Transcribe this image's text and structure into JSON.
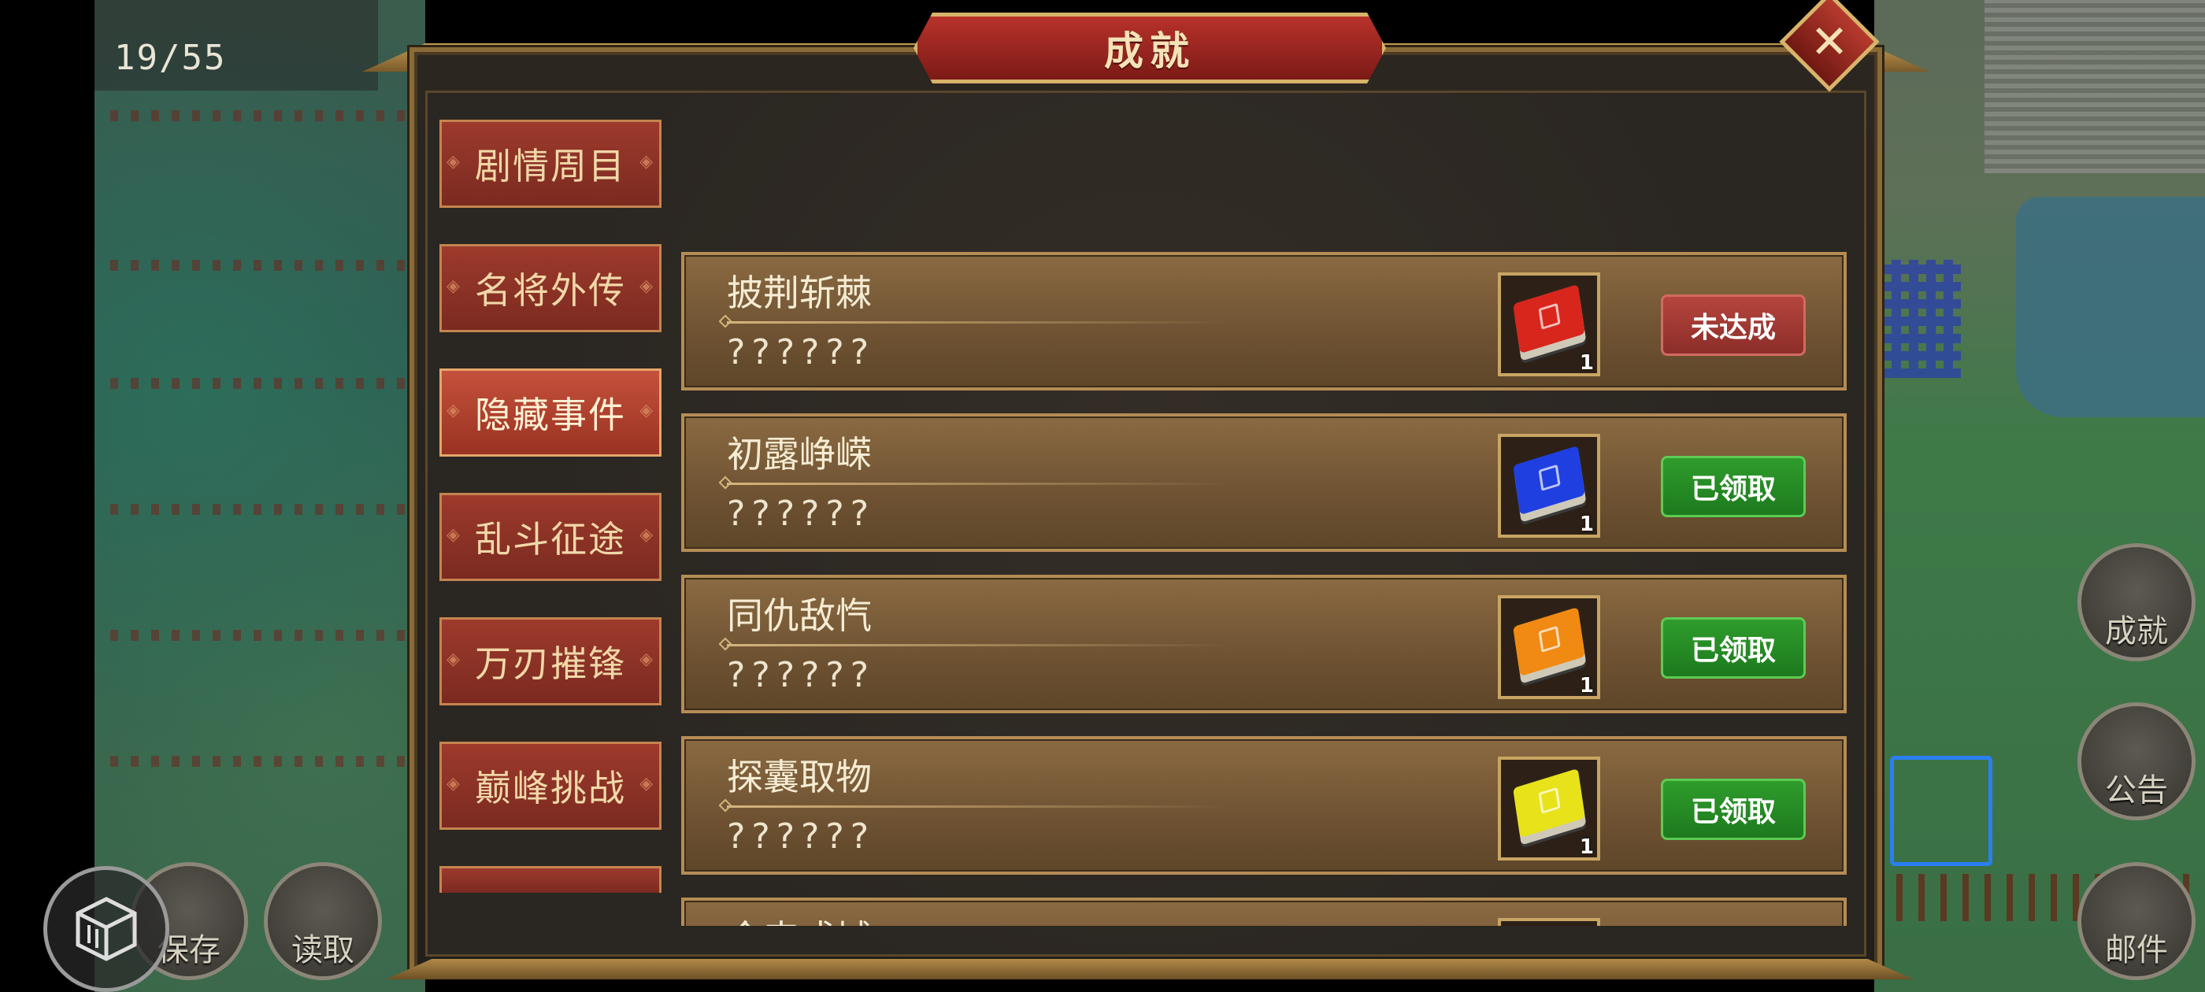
{
  "hud": {
    "counter": "19/55"
  },
  "modal": {
    "title": "成就",
    "close_symbol": "✕"
  },
  "tabs": [
    {
      "label": "剧情周目",
      "active": false
    },
    {
      "label": "名将外传",
      "active": false
    },
    {
      "label": "隐藏事件",
      "active": true
    },
    {
      "label": "乱斗征途",
      "active": false
    },
    {
      "label": "万刃摧锋",
      "active": false
    },
    {
      "label": "巅峰挑战",
      "active": false
    }
  ],
  "achievements": [
    {
      "name": "披荆斩棘",
      "description": "??????",
      "reward_icon": "red-book-icon",
      "reward_color": "#d8261d",
      "reward_qty": "1",
      "status": "未达成",
      "status_type": "fail"
    },
    {
      "name": "初露峥嵘",
      "description": "??????",
      "reward_icon": "blue-book-icon",
      "reward_color": "#1f3fe0",
      "reward_qty": "1",
      "status": "已领取",
      "status_type": "done"
    },
    {
      "name": "同仇敌忾",
      "description": "??????",
      "reward_icon": "orange-book-icon",
      "reward_color": "#f08a12",
      "reward_qty": "1",
      "status": "已领取",
      "status_type": "done"
    },
    {
      "name": "探囊取物",
      "description": "??????",
      "reward_icon": "yellow-book-icon",
      "reward_color": "#e8e21a",
      "reward_qty": "1",
      "status": "已领取",
      "status_type": "done"
    },
    {
      "name": "今来成城",
      "description": "",
      "reward_icon": "book-icon",
      "reward_color": "#8a6a2a",
      "reward_qty": "",
      "status": "",
      "status_type": ""
    }
  ],
  "side_buttons": {
    "achievements": "成就",
    "announcement": "公告",
    "mail": "邮件",
    "save": "保存",
    "load": "读取"
  }
}
